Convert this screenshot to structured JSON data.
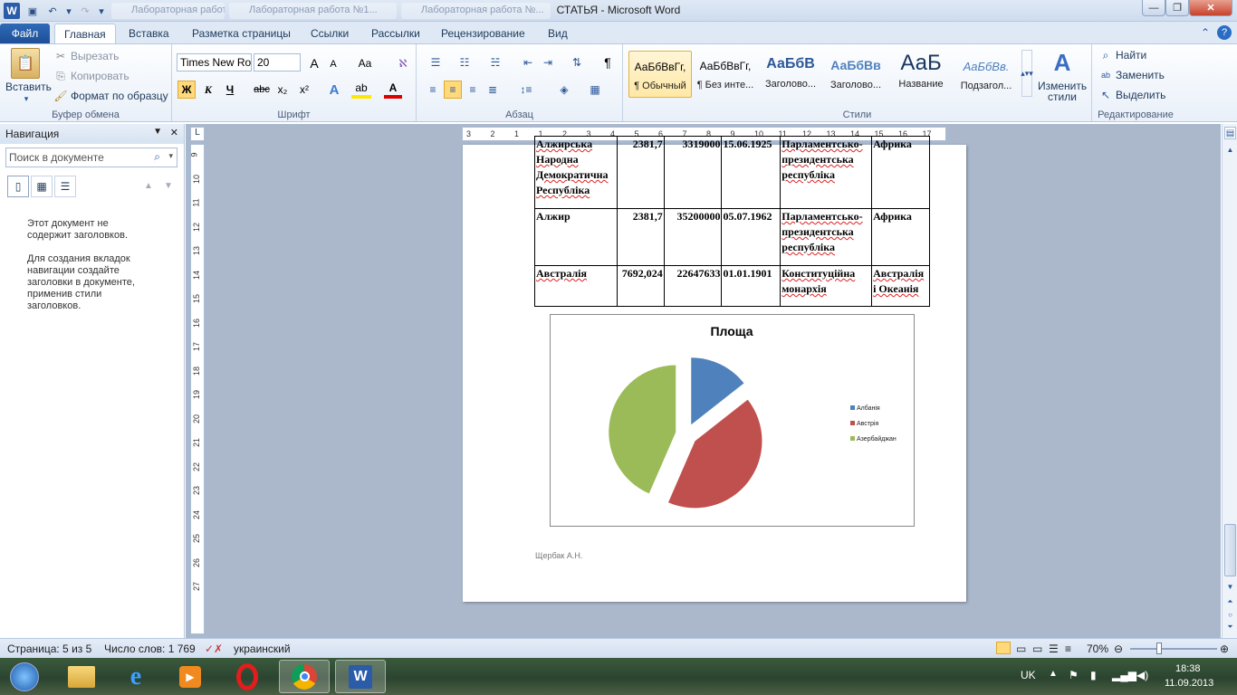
{
  "window": {
    "title": "СТАТЬЯ  -  Microsoft Word",
    "bg_tab1": "Лабораторная работа №1...",
    "bg_tab2": "Лабораторная работа №..."
  },
  "tabs": [
    {
      "label": "Файл"
    },
    {
      "label": "Главная"
    },
    {
      "label": "Вставка"
    },
    {
      "label": "Разметка страницы"
    },
    {
      "label": "Ссылки"
    },
    {
      "label": "Рассылки"
    },
    {
      "label": "Рецензирование"
    },
    {
      "label": "Вид"
    }
  ],
  "ribbon": {
    "clipboard": {
      "paste": "Вставить",
      "cut": "Вырезать",
      "copy": "Копировать",
      "format_painter": "Формат по образцу",
      "label": "Буфер обмена"
    },
    "font": {
      "name": "Times New Ro",
      "size": "20",
      "label": "Шрифт",
      "bold": "Ж",
      "italic": "К",
      "underline": "Ч",
      "strike": "abc",
      "sub": "x₂",
      "sup": "x²",
      "grow": "A",
      "shrink": "A",
      "case": "Aa"
    },
    "paragraph": {
      "label": "Абзац"
    },
    "styles": {
      "label": "Стили",
      "items": [
        {
          "preview": "АаБбВвГг,",
          "name": "¶ Обычный"
        },
        {
          "preview": "АаБбВвГг,",
          "name": "¶ Без инте..."
        },
        {
          "preview": "АаБбВ",
          "name": "Заголово..."
        },
        {
          "preview": "АаБбВв",
          "name": "Заголово..."
        },
        {
          "preview": "АаБ",
          "name": "Название"
        },
        {
          "preview": "АаБбВв.",
          "name": "Подзагол..."
        }
      ],
      "change": "Изменить стили"
    },
    "editing": {
      "find": "Найти",
      "replace": "Заменить",
      "select": "Выделить",
      "label": "Редактирование"
    }
  },
  "nav": {
    "title": "Навигация",
    "search_placeholder": "Поиск в документе",
    "msg1": "Этот документ не содержит заголовков.",
    "msg2": "Для создания вкладок навигации создайте заголовки в документе, применив стили заголовков."
  },
  "table": {
    "rows": [
      {
        "name": "Алжирська Народна Демократична Республіка",
        "area": "2381,7",
        "pop": "3319000",
        "date": "15.06.1925",
        "gov": "Парламентсько-президентська республіка",
        "region": "Африка"
      },
      {
        "name": "Алжир",
        "area": "2381,7",
        "pop": "35200000",
        "date": "05.07.1962",
        "gov": "Парламентсько-президентська республіка",
        "region": "Африка"
      },
      {
        "name": "Австралія",
        "area": "7692,024",
        "pop": "22647633",
        "date": "01.01.1901",
        "gov": "Конституційна монархія",
        "region": "Австралія і Океанія"
      }
    ]
  },
  "chart_data": {
    "type": "pie",
    "title": "Площа",
    "categories": [
      "Албанія",
      "Австрія",
      "Азербайджан"
    ],
    "values": [
      28.7,
      83.9,
      86.6
    ],
    "values_note_unknown_scale": false,
    "colors": [
      "#4f81bd",
      "#c0504d",
      "#9bbb59"
    ],
    "legend": "right"
  },
  "footer_text": "Щербак А.Н.",
  "status": {
    "page": "Страница: 5 из 5",
    "words": "Число слов: 1 769",
    "lang": "украинский",
    "zoom": "70%"
  },
  "tray": {
    "lang": "UK",
    "time": "18:38",
    "date": "11.09.2013"
  },
  "ruler": {
    "h": [
      "3",
      "2",
      "1",
      "1",
      "2",
      "3",
      "4",
      "5",
      "6",
      "7",
      "8",
      "9",
      "10",
      "11",
      "12",
      "13",
      "14",
      "15",
      "16",
      "17"
    ],
    "v": [
      "9",
      "10",
      "11",
      "12",
      "13",
      "14",
      "15",
      "16",
      "17",
      "18",
      "19",
      "20",
      "21",
      "22",
      "23",
      "24",
      "25",
      "26",
      "27"
    ]
  }
}
